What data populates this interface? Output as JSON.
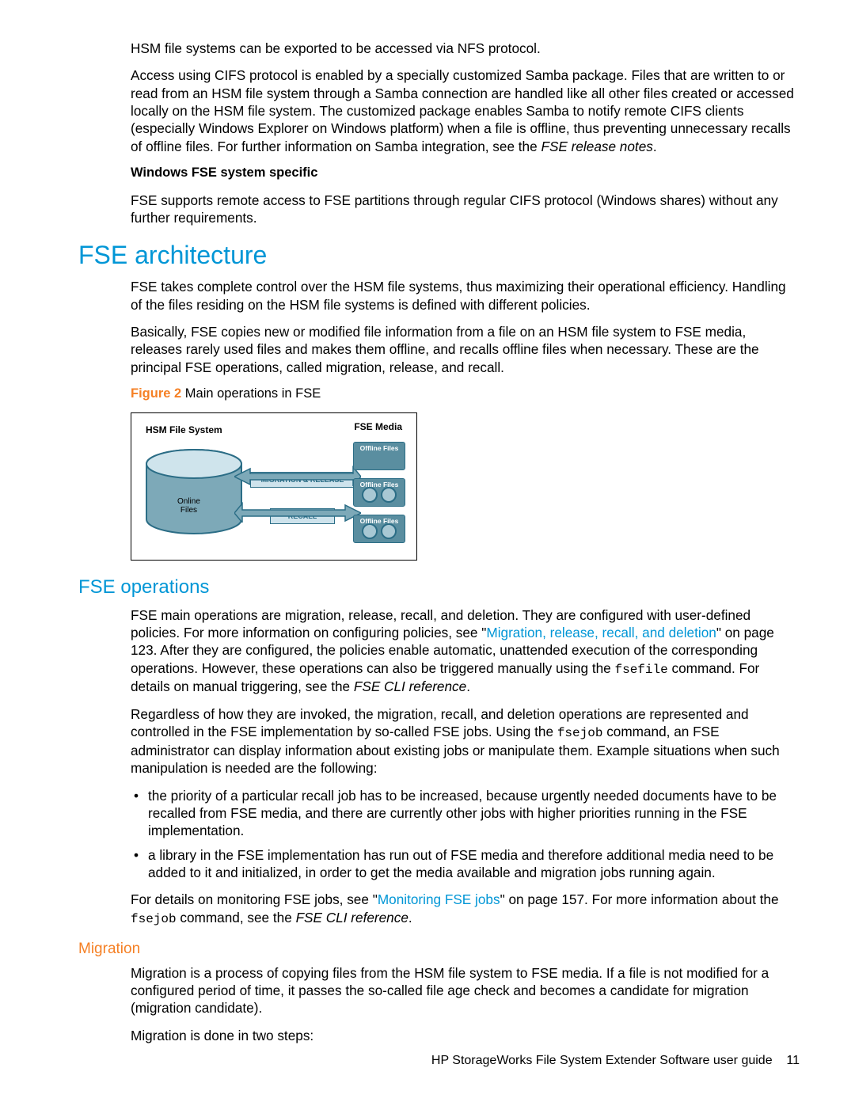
{
  "intro": {
    "p1": "HSM file systems can be exported to be accessed via NFS protocol.",
    "p2_a": "Access using CIFS protocol is enabled by a specially customized Samba package. Files that are written to or read from an HSM file system through a Samba connection are handled like all other files created or accessed locally on the HSM file system. The customized package enables Samba to notify remote CIFS clients (especially Windows Explorer on Windows platform) when a file is offline, thus preventing unnecessary recalls of offline files. For further information on Samba integration, see the ",
    "p2_b": "FSE release notes",
    "p2_c": ".",
    "subhead": "Windows FSE system specific",
    "p3": "FSE supports remote access to FSE partitions through regular CIFS protocol (Windows shares) without any further requirements."
  },
  "arch": {
    "h1": "FSE architecture",
    "p1": "FSE takes complete control over the HSM file systems, thus maximizing their operational efficiency. Handling of the files residing on the HSM file systems is defined with different policies.",
    "p2": "Basically, FSE copies new or modified file information from a file on an HSM file system to FSE media, releases rarely used files and makes them offline, and recalls offline files when necessary. These are the principal FSE operations, called migration, release, and recall.",
    "fig_label": "Figure 2",
    "fig_title": " Main operations in FSE"
  },
  "diagram": {
    "hsm_label": "HSM File System",
    "fse_media": "FSE Media",
    "online": "Online\nFiles",
    "migration": "MIGRATION & RELEASE",
    "recall": "RECALL",
    "offline": "Offline Files"
  },
  "ops": {
    "h2": "FSE operations",
    "p1_a": "FSE main operations are migration, release, recall, and deletion. They are configured with user-defined policies. For more information on configuring policies, see \"",
    "p1_link": "Migration, release, recall, and deletion",
    "p1_b": "\" on page 123. After they are configured, the policies enable automatic, unattended execution of the corresponding operations. However, these operations can also be triggered manually using the ",
    "p1_code": "fsefile",
    "p1_c": " command. For details on manual triggering, see the ",
    "p1_ref": "FSE CLI reference",
    "p1_d": ".",
    "p2_a": "Regardless of how they are invoked, the migration, recall, and deletion operations are represented and controlled in the FSE implementation by so-called FSE jobs. Using the ",
    "p2_code": "fsejob",
    "p2_b": " command, an FSE administrator can display information about existing jobs or manipulate them. Example situations when such manipulation is needed are the following:",
    "bullet1": "the priority of a particular recall job has to be increased, because urgently needed documents have to be recalled from FSE media, and there are currently other jobs with higher priorities running in the FSE implementation.",
    "bullet2": "a library in the FSE implementation has run out of FSE media and therefore additional media need to be added to it and initialized, in order to get the media available and migration jobs running again.",
    "p3_a": "For details on monitoring FSE jobs, see \"",
    "p3_link": "Monitoring FSE jobs",
    "p3_b": "\" on page 157. For more information about the ",
    "p3_code": "fsejob",
    "p3_c": " command, see the ",
    "p3_ref": "FSE CLI reference",
    "p3_d": "."
  },
  "mig": {
    "h3": "Migration",
    "p1": "Migration is a process of copying files from the HSM file system to FSE media. If a file is not modified for a configured period of time, it passes the so-called file age check and becomes a candidate for migration (migration candidate).",
    "p2": "Migration is done in two steps:"
  },
  "footer": {
    "title": "HP StorageWorks File System Extender Software user guide",
    "page": "11"
  }
}
